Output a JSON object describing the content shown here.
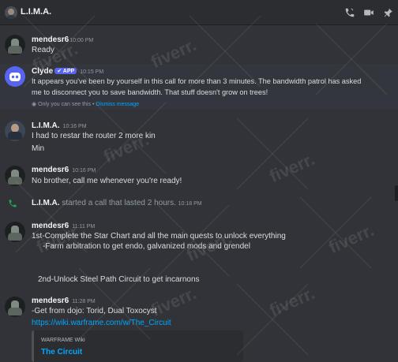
{
  "header": {
    "title": "L.I.M.A.",
    "icons": [
      "phone-call-icon",
      "video-call-icon",
      "pin-icon"
    ]
  },
  "messages": [
    {
      "author": "mendesr6",
      "time": "10:00 PM",
      "lines": [
        "Ready"
      ]
    },
    {
      "author": "Clyde",
      "badge": "APP",
      "time": "10:15 PM",
      "lines": [
        "It appears you've been by yourself in this call for more than 3 minutes. The bandwidth patrol has asked",
        "me to disconnect you to save bandwidth. That stuff doesn't grow on trees!"
      ],
      "ephemeral_note": "Only you can see this",
      "dismiss_label": "Dismiss message"
    },
    {
      "author": "L.I.M.A.",
      "time": "10:16 PM",
      "lines": [
        "I had to restar the router 2 more kin",
        "Min"
      ]
    },
    {
      "author": "mendesr6",
      "time": "10:16 PM",
      "lines": [
        "No brother, call me whenever you're ready!"
      ]
    },
    {
      "system": true,
      "author": "L.I.M.A.",
      "text": "started a call that lasted 2 hours.",
      "time": "10:18 PM"
    },
    {
      "author": "mendesr6",
      "time": "11:11 PM",
      "lines": [
        "1st-Complete the Star Chart and all the main quests to unlock everything",
        "    -Farm arbitration to get endo, galvanized mods and grendel",
        "",
        "2nd-Unlock Steel Path Circuit to get incarnons"
      ]
    },
    {
      "author": "mendesr6",
      "time": "11:28 PM",
      "lines": [
        "-Get from dojo: Torid, Dual Toxocyst"
      ],
      "link": "https://wiki.warframe.com/w/The_Circuit",
      "embed": {
        "provider": "WARFRAME Wiki",
        "title": "The Circuit"
      }
    }
  ],
  "watermark": "fiverr."
}
